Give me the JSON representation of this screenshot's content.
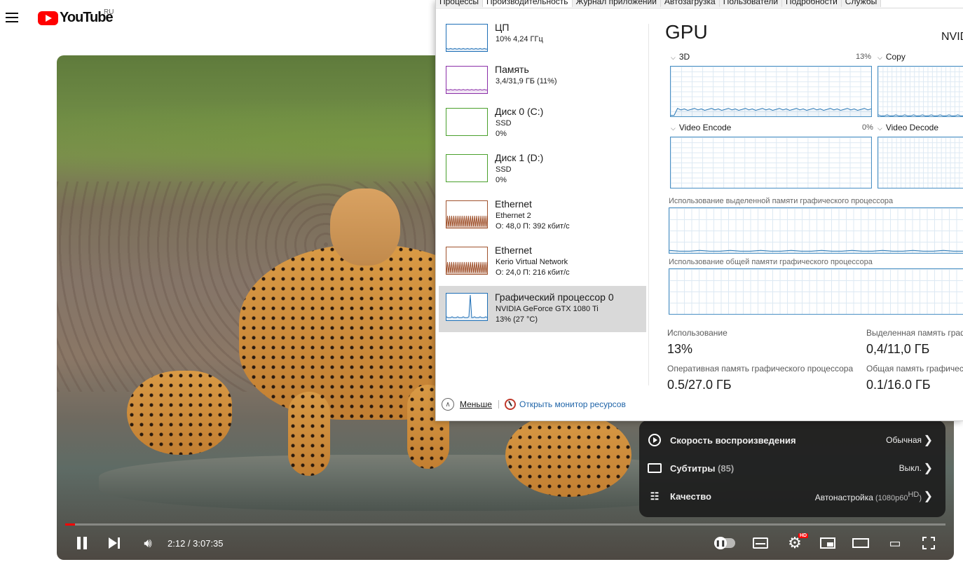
{
  "youtube": {
    "logo_text": "YouTube",
    "region": "RU",
    "player": {
      "progress": 0.0115,
      "time": "2:12 / 3:07:35",
      "hd_badge": "HD"
    },
    "settings_menu": [
      {
        "label": "Скорость воспроизведения",
        "extra": "",
        "value": "Обычная",
        "value_extra": "",
        "value_sup": ""
      },
      {
        "label": "Субтитры",
        "extra": " (85)",
        "value": "Выкл.",
        "value_extra": "",
        "value_sup": ""
      },
      {
        "label": "Качество",
        "extra": "",
        "value": "Автонастройка",
        "value_extra": " (1080p60",
        "value_sup": "HD",
        "value_close": ")"
      }
    ]
  },
  "task_manager": {
    "tabs": [
      "Процессы",
      "Производительность",
      "Журнал приложений",
      "Автозагрузка",
      "Пользователи",
      "Подробности",
      "Службы"
    ],
    "active_tab": 1,
    "sidebar": [
      {
        "title": "ЦП",
        "line2": "10% 4,24 ГГц",
        "line3": "",
        "color": "#1e6fb6"
      },
      {
        "title": "Память",
        "line2": "3,4/31,9 ГБ (11%)",
        "line3": "",
        "color": "#8b2fa8"
      },
      {
        "title": "Диск 0 (C:)",
        "line2": "SSD",
        "line3": "0%",
        "color": "#4aa02c"
      },
      {
        "title": "Диск 1 (D:)",
        "line2": "SSD",
        "line3": "0%",
        "color": "#4aa02c"
      },
      {
        "title": "Ethernet",
        "line2": "Ethernet 2",
        "line3": "О: 48,0  П: 392 кбит/с",
        "color": "#a0522d"
      },
      {
        "title": "Ethernet",
        "line2": "Kerio Virtual Network",
        "line3": "О: 24,0  П: 216 кбит/с",
        "color": "#a0522d"
      },
      {
        "title": "Графический процессор 0",
        "line2": "NVIDIA GeForce GTX 1080 Ti",
        "line3": "13%  (27 °C)",
        "color": "#1e6fb6"
      }
    ],
    "active_item": 6,
    "gpu": {
      "title": "GPU",
      "name": "NVID",
      "engines": [
        {
          "label": "3D",
          "percent": "13%"
        },
        {
          "label": "Copy",
          "percent": ""
        },
        {
          "label": "Video Encode",
          "percent": "0%"
        },
        {
          "label": "Video Decode",
          "percent": ""
        }
      ],
      "dedicated_label": "Использование выделенной памяти графического процессора",
      "shared_label": "Использование общей памяти графического процессора",
      "stats": [
        {
          "label": "Использование",
          "value": "13%"
        },
        {
          "label": "Выделенная память граф",
          "value": "0,4/11,0 ГБ"
        },
        {
          "label": "Оперативная память графического процессора",
          "value": "0,5/27,0 ГБ"
        },
        {
          "label": "Общая память графическ",
          "value": "0,1/16,0 ГБ"
        }
      ]
    },
    "footer": {
      "less": "Меньше",
      "monitor": "Открыть монитор ресурсов"
    }
  }
}
